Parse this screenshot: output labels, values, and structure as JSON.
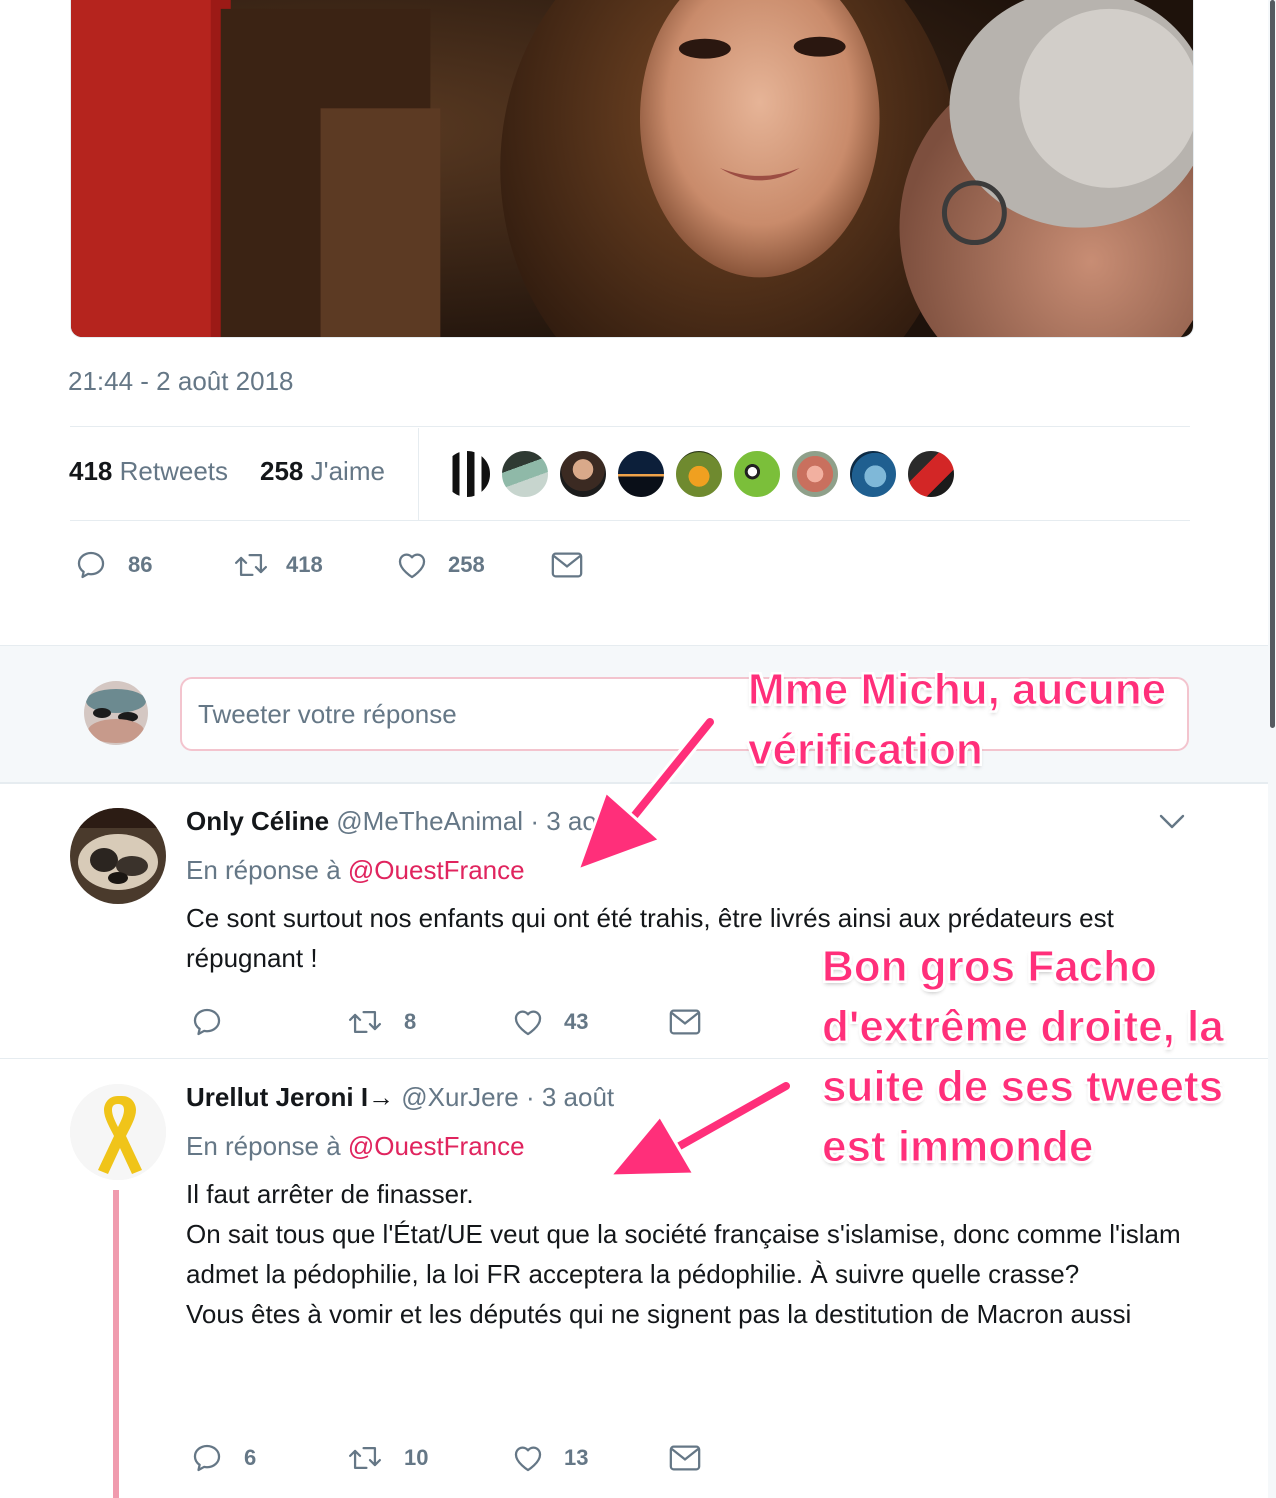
{
  "tweet": {
    "timestamp": "21:44 - 2 août 2018",
    "retweets_count": "418",
    "retweets_label": "Retweets",
    "likes_count": "258",
    "likes_label": "J'aime",
    "actions": {
      "replies": "86",
      "retweets": "418",
      "likes": "258"
    }
  },
  "compose": {
    "placeholder": "Tweeter votre réponse"
  },
  "replies": [
    {
      "name": "Only Céline",
      "handle": "@MeTheAnimal",
      "date": "· 3 août",
      "reply_prefix": "En réponse à",
      "reply_to": "@OuestFrance",
      "text": "Ce sont surtout nos enfants qui ont été trahis, être livrés ainsi aux prédateurs est répugnant !",
      "actions": {
        "replies": "",
        "retweets": "8",
        "likes": "43"
      }
    },
    {
      "name": "Urellut Jeroni I→",
      "handle": "@XurJere",
      "date": "· 3 août",
      "reply_prefix": "En réponse à",
      "reply_to": "@OuestFrance",
      "text_lines": [
        "Il faut arrêter de finasser.",
        "On sait tous que l'État/UE veut que la société française s'islamise, donc comme l'islam admet la pédophilie, la loi FR acceptera la pédophilie. À suivre quelle crasse?",
        "Vous êtes à vomir et les députés qui ne signent pas la destitution de Macron aussi"
      ],
      "actions": {
        "replies": "6",
        "retweets": "10",
        "likes": "13"
      }
    }
  ],
  "annotations": {
    "first": [
      "Mme Michu, aucune",
      "vérification"
    ],
    "second": [
      "Bon gros Facho",
      "d'extrême droite, la",
      "suite de ses tweets",
      "est immonde"
    ]
  },
  "colors": {
    "accent": "#e0245e",
    "annotation": "#ff2f7a",
    "muted": "#657786"
  },
  "icons": [
    "reply-icon",
    "retweet-icon",
    "like-icon",
    "dm-icon",
    "chevron-down-icon"
  ]
}
